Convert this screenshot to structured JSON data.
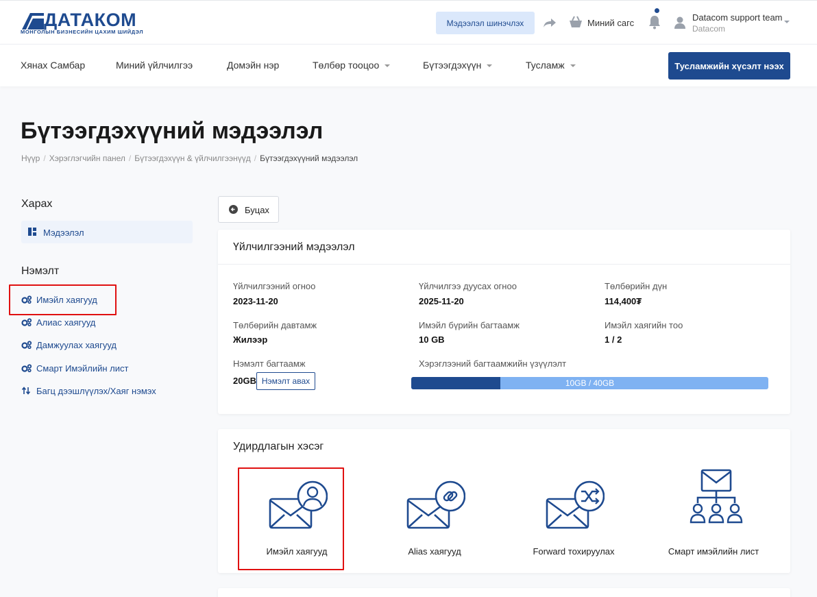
{
  "brand": {
    "name": "ДАТАКОМ",
    "tagline": "МОНГОЛЫН БИЗНЕСИЙН ЦАХИМ ШИЙДЭЛ",
    "color": "#1e4a8f"
  },
  "header": {
    "refresh_label": "Мэдээлэл шинэчлэх",
    "cart_label": "Миний сагс",
    "user_name": "Datacom support team",
    "user_org": "Datacom"
  },
  "nav": {
    "items": [
      {
        "label": "Хянах Самбар"
      },
      {
        "label": "Миний үйлчилгээ"
      },
      {
        "label": "Домэйн нэр"
      },
      {
        "label": "Төлбөр тооцоо"
      },
      {
        "label": "Бүтээгдэхүүн"
      },
      {
        "label": "Тусламж"
      }
    ],
    "support_button": "Тусламжийн хүсэлт нээх"
  },
  "page": {
    "title": "Бүтээгдэхүүний мэдээлэл",
    "breadcrumb": [
      "Нүүр",
      "Хэрэглэгчийн панел",
      "Бүтээгдэхүүн & үйлчилгээнүүд",
      "Бүтээгдэхүүний мэдээлэл"
    ]
  },
  "sidebar": {
    "view_heading": "Харах",
    "view_item": "Мэдээлэл",
    "extra_heading": "Нэмэлт",
    "extra_items": [
      {
        "label": "Имэйл хаягууд"
      },
      {
        "label": "Алиас хаягууд"
      },
      {
        "label": "Дамжуулах хаягууд"
      },
      {
        "label": "Смарт Имэйлийн лист"
      },
      {
        "label": "Багц дээшлүүлэх/Хаяг нэмэх"
      }
    ]
  },
  "back_label": "Буцах",
  "service_info": {
    "title": "Үйлчилгээний мэдээлэл",
    "fields": [
      {
        "label": "Үйлчилгээний огноо",
        "value": "2023-11-20"
      },
      {
        "label": "Үйлчилгээ дуусах огноо",
        "value": "2025-11-20"
      },
      {
        "label": "Төлбөрийн дүн",
        "value": "114,400₮"
      },
      {
        "label": "Төлбөрийн давтамж",
        "value": "Жилээр"
      },
      {
        "label": "Имэйл бүрийн багтаамж",
        "value": "10 GB"
      },
      {
        "label": "Имэйл хаягийн тоо",
        "value": "1 / 2"
      }
    ],
    "addon_label": "Нэмэлт багтаамж",
    "addon_value": "20GB",
    "addon_button": "Нэмэлт авах",
    "usage_label": "Хэрэглээний багтаамжийн үзүүлэлт",
    "usage_text": "10GB / 40GB",
    "usage_fraction": 0.25
  },
  "control": {
    "title": "Удирдлагын хэсэг",
    "tiles": [
      {
        "label": "Имэйл хаягууд",
        "icon": "email-user-icon"
      },
      {
        "label": "Alias хаягууд",
        "icon": "email-link-icon"
      },
      {
        "label": "Forward тохируулах",
        "icon": "email-forward-icon"
      },
      {
        "label": "Смарт имэйлийн лист",
        "icon": "email-list-icon"
      }
    ]
  }
}
